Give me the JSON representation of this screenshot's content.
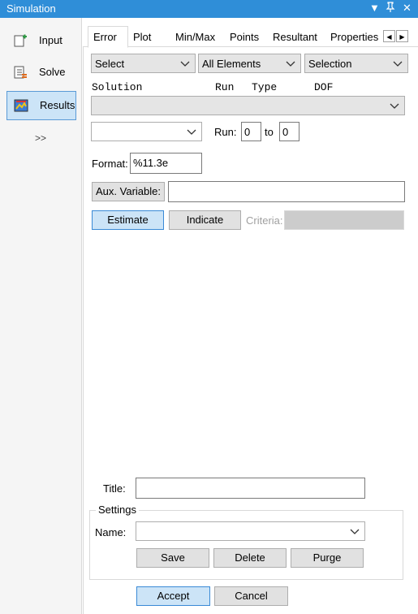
{
  "window": {
    "title": "Simulation"
  },
  "nav": {
    "items": [
      {
        "label": "Input",
        "icon": "input-icon"
      },
      {
        "label": "Solve",
        "icon": "solve-icon"
      },
      {
        "label": "Results",
        "icon": "results-icon"
      }
    ],
    "more": ">>"
  },
  "tabs": [
    "Error",
    "Plot",
    "Min/Max",
    "Points",
    "Resultant",
    "Properties"
  ],
  "filters": {
    "select": "Select",
    "elements": "All Elements",
    "selection": "Selection"
  },
  "solution_header": {
    "solution": "Solution",
    "run": "Run",
    "type": "Type",
    "dof": "DOF"
  },
  "run": {
    "label": "Run:",
    "from": "0",
    "to_label": "to",
    "to": "0"
  },
  "format": {
    "label": "Format:",
    "value": "%11.3e"
  },
  "aux": {
    "button": "Aux. Variable:",
    "value": ""
  },
  "actions": {
    "estimate": "Estimate",
    "indicate": "Indicate",
    "criteria": "Criteria:"
  },
  "title_field": {
    "label": "Title:",
    "value": ""
  },
  "settings": {
    "legend": "Settings",
    "name_label": "Name:",
    "save": "Save",
    "delete": "Delete",
    "purge": "Purge"
  },
  "footer": {
    "accept": "Accept",
    "cancel": "Cancel"
  },
  "colors": {
    "titlebar": "#2f8ed8",
    "selected_bg": "#cce4f7",
    "selected_border": "#3a8ad6"
  }
}
